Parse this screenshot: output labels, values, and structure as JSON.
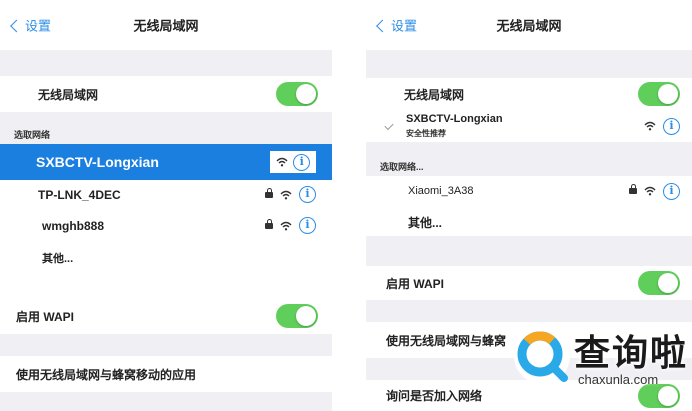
{
  "left": {
    "nav": {
      "back_label": "设置",
      "title": "无线局域网"
    },
    "wifi_row": {
      "label": "无线局域网",
      "toggle_on": true
    },
    "section_choose": "选取网络",
    "networks": [
      {
        "name": "SXBCTV-Longxian",
        "secured": false,
        "selected": true
      },
      {
        "name": "TP-LNK_4DEC",
        "secured": true,
        "selected": false
      },
      {
        "name": "wmghb888",
        "secured": true,
        "selected": false
      }
    ],
    "other_label": "其他...",
    "wapi_row": {
      "label": "启用 WAPI",
      "toggle_on": true
    },
    "cellular_row": {
      "label": "使用无线局域网与蜂窝移动的应用"
    }
  },
  "right": {
    "nav": {
      "back_label": "设置",
      "title": "无线局域网"
    },
    "wifi_row": {
      "label": "无线局域网",
      "toggle_on": true
    },
    "connected": {
      "name": "SXBCTV-Longxian",
      "note": "安全性推荐"
    },
    "section_choose": "选取网络...",
    "networks": [
      {
        "name": "Xiaomi_3A38",
        "secured": true
      }
    ],
    "other_label": "其他...",
    "wapi_row": {
      "label": "启用 WAPI",
      "toggle_on": true
    },
    "cellular_row": {
      "label": "使用无线局域网与蜂窝"
    },
    "ask_row": {
      "label": "询问是否加入网络",
      "toggle_on": true
    }
  },
  "watermark": {
    "name": "查询啦",
    "url": "chaxunla.com"
  },
  "colors": {
    "accent": "#2c8de6",
    "toggle": "#5fce5a",
    "selected": "#1b7fe0",
    "background": "#efeff4"
  }
}
